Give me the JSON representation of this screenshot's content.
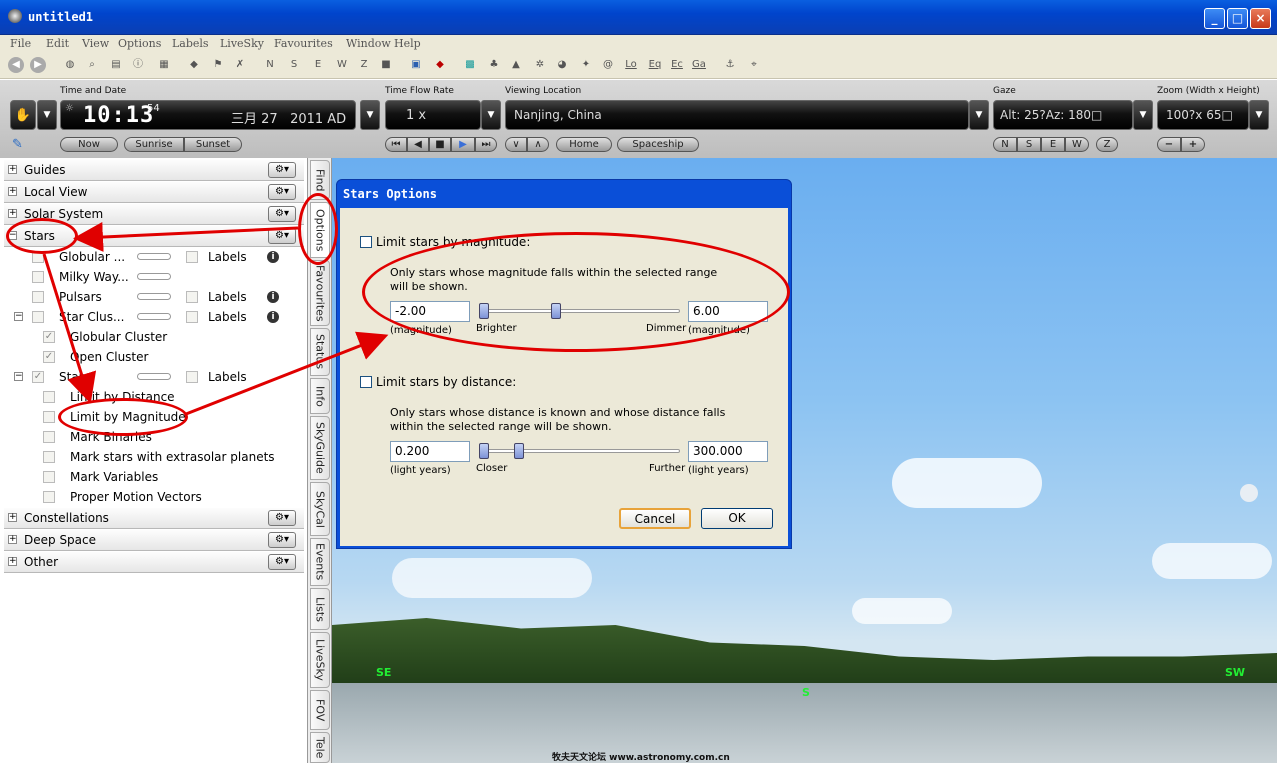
{
  "window": {
    "title": "untitled1",
    "minimize": "_",
    "maximize": "□",
    "close": "×"
  },
  "menu": [
    "File",
    "Edit",
    "View",
    "Options",
    "Labels",
    "LiveSky",
    "Favourites",
    "Window",
    "Help"
  ],
  "toolbar_text": [
    "N",
    "S",
    "E",
    "W",
    "Z",
    "Lo",
    "Eq",
    "Ec",
    "Ga"
  ],
  "panel": {
    "time_label": "Time and Date",
    "clock": "10:13",
    "seconds": "54",
    "date": "三月 27   2011 AD",
    "now": "Now",
    "sunrise": "Sunrise",
    "sunset": "Sunset",
    "flow_label": "Time Flow Rate",
    "flow_value": "1 x",
    "location_label": "Viewing Location",
    "location_value": "Nanjing, China",
    "home": "Home",
    "spaceship": "Spaceship",
    "gaze_label": "Gaze",
    "gaze_value": "Alt: 25?Az: 180□",
    "gaze_dirs": [
      "N",
      "S",
      "E",
      "W",
      "Z"
    ],
    "zoom_label": "Zoom (Width x Height)",
    "zoom_value": "100?x 65□",
    "zoom_minus": "−",
    "zoom_plus": "+"
  },
  "left": {
    "sections_top": [
      "Guides",
      "Local View",
      "Solar System",
      "Stars"
    ],
    "items": [
      {
        "label": "Globular ...",
        "labels": "Labels"
      },
      {
        "label": "Milky Way..."
      },
      {
        "label": "Pulsars",
        "labels": "Labels"
      },
      {
        "label": "Star Clus...",
        "labels": "Labels"
      },
      {
        "label": "Globular Cluster"
      },
      {
        "label": "Open Cluster"
      },
      {
        "label": "Stars",
        "labels": "Labels"
      },
      {
        "label": "Limit by Distance"
      },
      {
        "label": "Limit by Magnitude"
      },
      {
        "label": "Mark Binaries"
      },
      {
        "label": "Mark stars with extrasolar planets"
      },
      {
        "label": "Mark Variables"
      },
      {
        "label": "Proper Motion Vectors"
      }
    ],
    "sections_bottom": [
      "Constellations",
      "Deep Space",
      "Other"
    ]
  },
  "tabs": [
    "Find",
    "Options",
    "Favourites",
    "Status",
    "Info",
    "SkyGuide",
    "SkyCal",
    "Events",
    "Lists",
    "LiveSky",
    "FOV",
    "Tele"
  ],
  "dialog": {
    "title": "Stars Options",
    "mag_check": "Limit stars by magnitude:",
    "mag_desc": "Only stars whose magnitude falls within the selected range will be shown.",
    "mag_min": "-2.00",
    "mag_max": "6.00",
    "mag_unit": "(magnitude)",
    "brighter": "Brighter",
    "dimmer": "Dimmer",
    "dist_check": "Limit stars by distance:",
    "dist_desc": "Only stars whose distance is known and whose distance falls within the selected range will be shown.",
    "dist_min": "0.200",
    "dist_max": "300.000",
    "dist_unit": "(light years)",
    "closer": "Closer",
    "further": "Further",
    "cancel": "Cancel",
    "ok": "OK"
  },
  "sky": {
    "compass_se": "SE",
    "compass_s": "S",
    "compass_sw": "SW",
    "watermark": "牧夫天文论坛 www.astronomy.com.cn"
  },
  "colors": {
    "title_blue": "#0a4fd8",
    "annotation_red": "#e00000",
    "compass_green": "#22ee33"
  }
}
